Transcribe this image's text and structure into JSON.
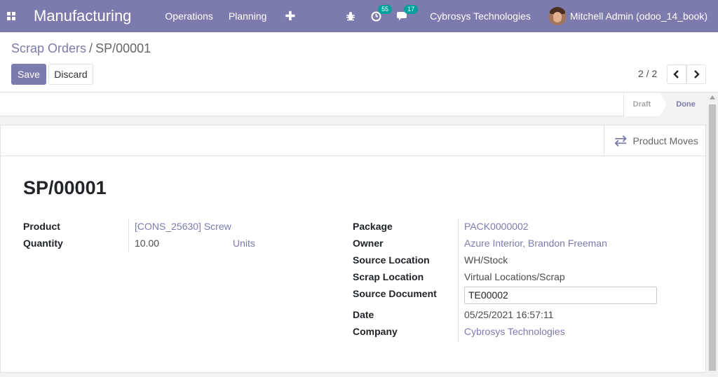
{
  "navbar": {
    "app_name": "Manufacturing",
    "menu": [
      "Operations",
      "Planning"
    ],
    "new_icon": "plus-icon",
    "activity_badge": "55",
    "messages_badge": "17",
    "company": "Cybrosys Technologies",
    "user": "Mitchell Admin (odoo_14_book)",
    "color": "#7c7bad"
  },
  "breadcrumb": {
    "parent": "Scrap Orders",
    "separator": "/",
    "current": "SP/00001"
  },
  "buttons": {
    "save": "Save",
    "discard": "Discard"
  },
  "pager": {
    "value": "2 / 2"
  },
  "statusbar": {
    "steps": [
      "Draft",
      "Done"
    ],
    "active": "Done"
  },
  "smart_buttons": {
    "product_moves": "Product Moves"
  },
  "record": {
    "name": "SP/00001"
  },
  "left_fields": {
    "product_label": "Product",
    "product_value": "[CONS_25630] Screw",
    "quantity_label": "Quantity",
    "quantity_value": "10.00",
    "uom_value": "Units"
  },
  "right_fields": {
    "package_label": "Package",
    "package_value": "PACK0000002",
    "owner_label": "Owner",
    "owner_value": "Azure Interior, Brandon Freeman",
    "source_location_label": "Source Location",
    "source_location_value": "WH/Stock",
    "scrap_location_label": "Scrap Location",
    "scrap_location_value": "Virtual Locations/Scrap",
    "source_document_label": "Source Document",
    "source_document_value": "TE00002",
    "date_label": "Date",
    "date_value": "05/25/2021 16:57:11",
    "company_label": "Company",
    "company_value": "Cybrosys Technologies"
  }
}
